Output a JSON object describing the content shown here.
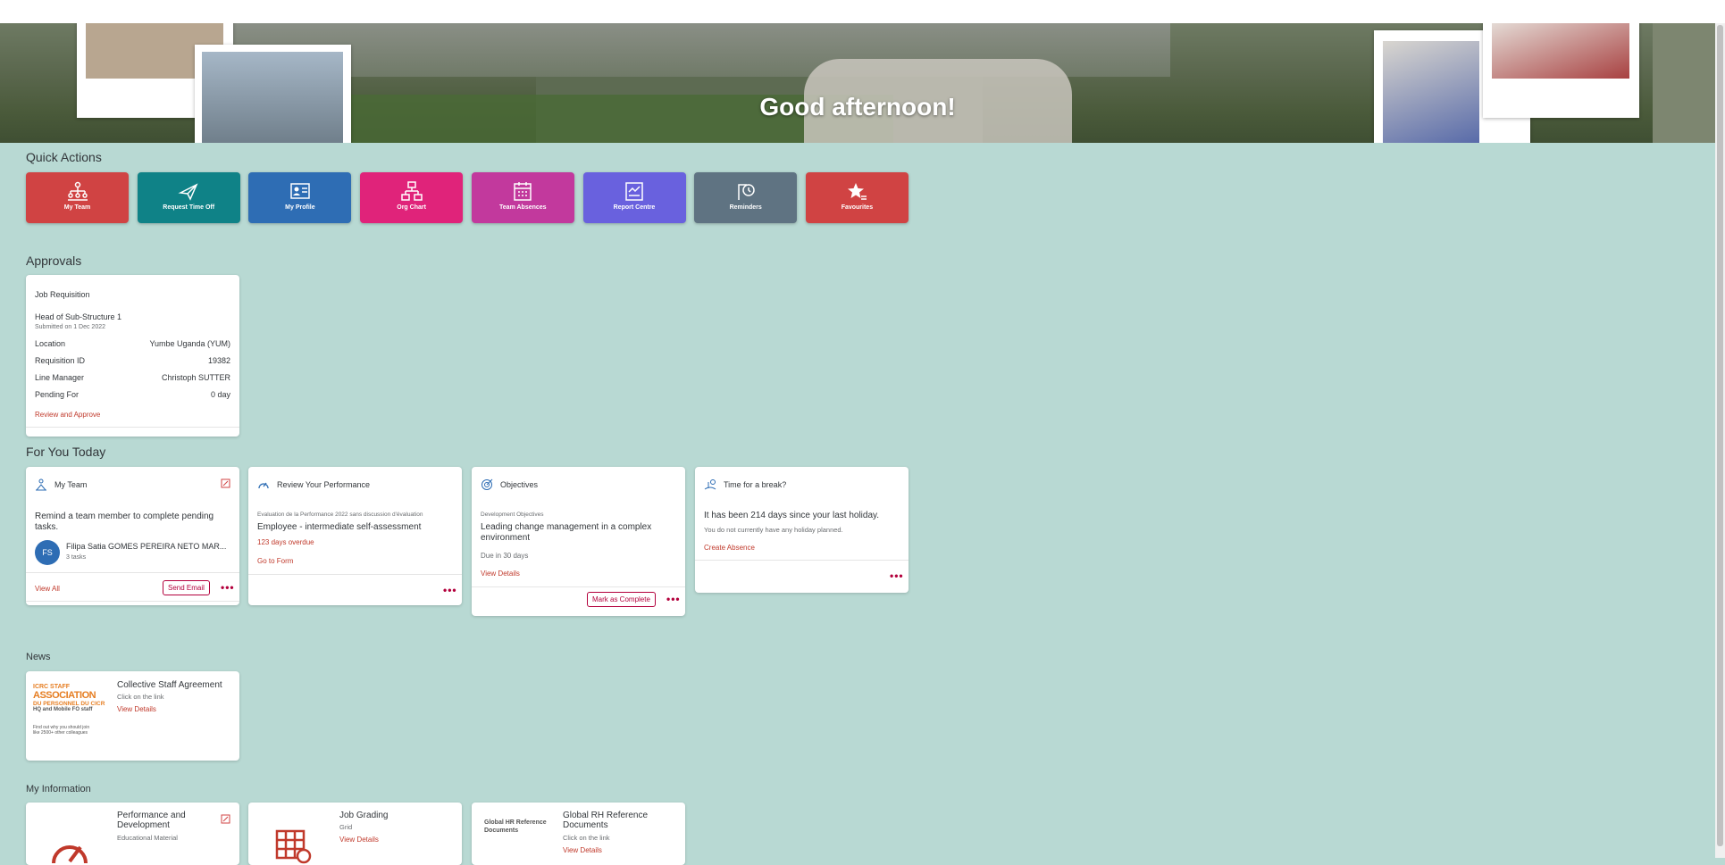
{
  "hero": {
    "greeting": "Good afternoon!"
  },
  "quick_actions": {
    "title": "Quick Actions",
    "items": [
      {
        "label": "My Team",
        "icon": "team-icon",
        "color": "#d04343"
      },
      {
        "label": "Request Time Off",
        "icon": "airplane-icon",
        "color": "#0f8287"
      },
      {
        "label": "My Profile",
        "icon": "profile-card-icon",
        "color": "#2e6db4"
      },
      {
        "label": "Org Chart",
        "icon": "org-chart-icon",
        "color": "#e0237a"
      },
      {
        "label": "Team Absences",
        "icon": "calendar-icon",
        "color": "#c2399d"
      },
      {
        "label": "Report Centre",
        "icon": "report-icon",
        "color": "#6961de"
      },
      {
        "label": "Reminders",
        "icon": "reminder-icon",
        "color": "#5f7382"
      },
      {
        "label": "Favourites",
        "icon": "star-list-icon",
        "color": "#d04343"
      }
    ]
  },
  "approvals": {
    "title": "Approvals",
    "card": {
      "type": "Job Requisition",
      "position": "Head of Sub-Structure 1",
      "submitted": "Submitted on 1 Dec 2022",
      "rows": [
        {
          "label": "Location",
          "value": "Yumbe Uganda (YUM)"
        },
        {
          "label": "Requisition ID",
          "value": "19382"
        },
        {
          "label": "Line Manager",
          "value": "Christoph SUTTER"
        },
        {
          "label": "Pending For",
          "value": "0 day"
        }
      ],
      "action": "Review and Approve"
    }
  },
  "for_you_today": {
    "title": "For You Today",
    "my_team": {
      "title": "My Team",
      "message": "Remind a team member to complete pending tasks.",
      "avatar": "FS",
      "person": "Filipa Satia GOMES PEREIRA NETO MAR...",
      "tasks": "3 tasks",
      "view_all": "View All",
      "send_email": "Send Email",
      "more": "•••"
    },
    "performance": {
      "title": "Review Your Performance",
      "subtitle": "Evaluation de la Performance 2022 sans discussion d'évaluation",
      "item": "Employee - intermediate self-assessment",
      "overdue": "123 days overdue",
      "action": "Go to Form",
      "more": "•••"
    },
    "objectives": {
      "title": "Objectives",
      "subtitle": "Development Objectives",
      "item": "Leading change management in a complex environment",
      "due": "Due in 30 days",
      "action": "View Details",
      "mark_complete": "Mark as Complete",
      "more": "•••"
    },
    "break": {
      "title": "Time for a break?",
      "message": "It has been 214 days since your last holiday.",
      "sub": "You do not currently have any holiday planned.",
      "action": "Create Absence",
      "more": "•••"
    }
  },
  "news": {
    "title": "News",
    "item": {
      "logo_lines": [
        "ICRC STAFF",
        "ASSOCIATION",
        "DU PERSONNEL DU CICR",
        "HQ and Mobile FO staff",
        "Find out why you should join",
        "like 2500+ other colleagues"
      ],
      "title": "Collective Staff Agreement",
      "sub": "Click on the link",
      "action": "View Details"
    }
  },
  "my_information": {
    "title": "My Information",
    "cards": [
      {
        "title": "Performance and Development",
        "sub": "Educational Material",
        "action": ""
      },
      {
        "title": "Job Grading",
        "sub": "Grid",
        "action": "View Details"
      },
      {
        "title": "Global RH Reference Documents",
        "sub": "Click on the link",
        "action": "View Details",
        "logo": "Global HR Reference Documents"
      }
    ]
  }
}
